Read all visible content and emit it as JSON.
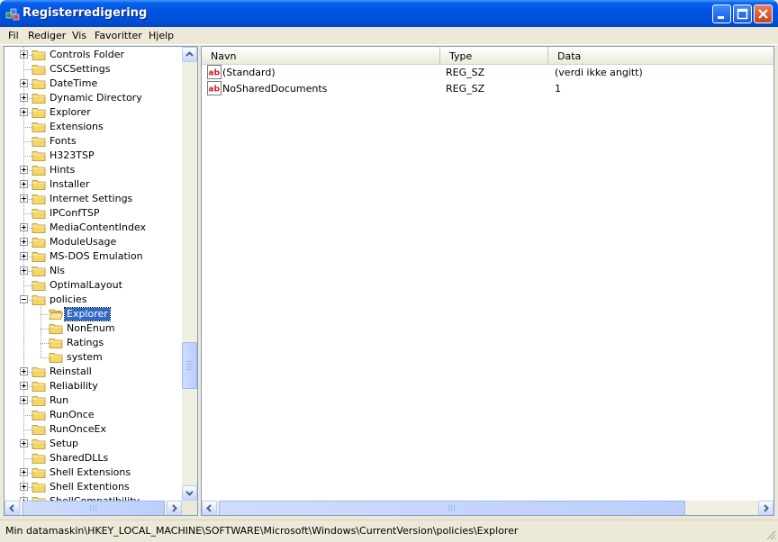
{
  "window": {
    "title": "Registerredigering"
  },
  "menu": {
    "items": [
      {
        "label": "Fil"
      },
      {
        "label": "Rediger"
      },
      {
        "label": "Vis"
      },
      {
        "label": "Favoritter"
      },
      {
        "label": "Hjelp"
      }
    ]
  },
  "tree": {
    "nodes": [
      {
        "label": "Controls Folder",
        "expander": "plus",
        "level": 0
      },
      {
        "label": "CSCSettings",
        "expander": "none",
        "level": 0
      },
      {
        "label": "DateTime",
        "expander": "plus",
        "level": 0
      },
      {
        "label": "Dynamic Directory",
        "expander": "plus",
        "level": 0
      },
      {
        "label": "Explorer",
        "expander": "plus",
        "level": 0
      },
      {
        "label": "Extensions",
        "expander": "none",
        "level": 0
      },
      {
        "label": "Fonts",
        "expander": "none",
        "level": 0
      },
      {
        "label": "H323TSP",
        "expander": "none",
        "level": 0
      },
      {
        "label": "Hints",
        "expander": "plus",
        "level": 0
      },
      {
        "label": "Installer",
        "expander": "plus",
        "level": 0
      },
      {
        "label": "Internet Settings",
        "expander": "plus",
        "level": 0
      },
      {
        "label": "IPConfTSP",
        "expander": "none",
        "level": 0
      },
      {
        "label": "MediaContentIndex",
        "expander": "plus",
        "level": 0
      },
      {
        "label": "ModuleUsage",
        "expander": "plus",
        "level": 0
      },
      {
        "label": "MS-DOS Emulation",
        "expander": "plus",
        "level": 0
      },
      {
        "label": "Nls",
        "expander": "plus",
        "level": 0
      },
      {
        "label": "OptimalLayout",
        "expander": "none",
        "level": 0
      },
      {
        "label": "policies",
        "expander": "minus",
        "level": 0
      },
      {
        "label": "Explorer",
        "expander": "none",
        "level": 1,
        "selected": true
      },
      {
        "label": "NonEnum",
        "expander": "none",
        "level": 1
      },
      {
        "label": "Ratings",
        "expander": "none",
        "level": 1
      },
      {
        "label": "system",
        "expander": "none",
        "level": 1
      },
      {
        "label": "Reinstall",
        "expander": "plus",
        "level": 0
      },
      {
        "label": "Reliability",
        "expander": "plus",
        "level": 0
      },
      {
        "label": "Run",
        "expander": "plus",
        "level": 0
      },
      {
        "label": "RunOnce",
        "expander": "none",
        "level": 0
      },
      {
        "label": "RunOnceEx",
        "expander": "none",
        "level": 0
      },
      {
        "label": "Setup",
        "expander": "plus",
        "level": 0
      },
      {
        "label": "SharedDLLs",
        "expander": "none",
        "level": 0
      },
      {
        "label": "Shell Extensions",
        "expander": "plus",
        "level": 0
      },
      {
        "label": "Shell Extentions",
        "expander": "plus",
        "level": 0
      },
      {
        "label": "ShellCompatibility",
        "expander": "plus",
        "level": 0
      }
    ]
  },
  "list": {
    "columns": [
      {
        "label": "Navn"
      },
      {
        "label": "Type"
      },
      {
        "label": "Data"
      }
    ],
    "rows": [
      {
        "name": "(Standard)",
        "type": "REG_SZ",
        "data": "(verdi ikke angitt)",
        "icon": "string-value-icon"
      },
      {
        "name": "NoSharedDocuments",
        "type": "REG_SZ",
        "data": "1",
        "icon": "string-value-icon"
      }
    ]
  },
  "status": {
    "path": "Min datamaskin\\HKEY_LOCAL_MACHINE\\SOFTWARE\\Microsoft\\Windows\\CurrentVersion\\policies\\Explorer"
  },
  "colors": {
    "titlebar": "#0054e3",
    "selection": "#316ac5",
    "folder": "#f6d56a",
    "chrome": "#ece9d8"
  }
}
